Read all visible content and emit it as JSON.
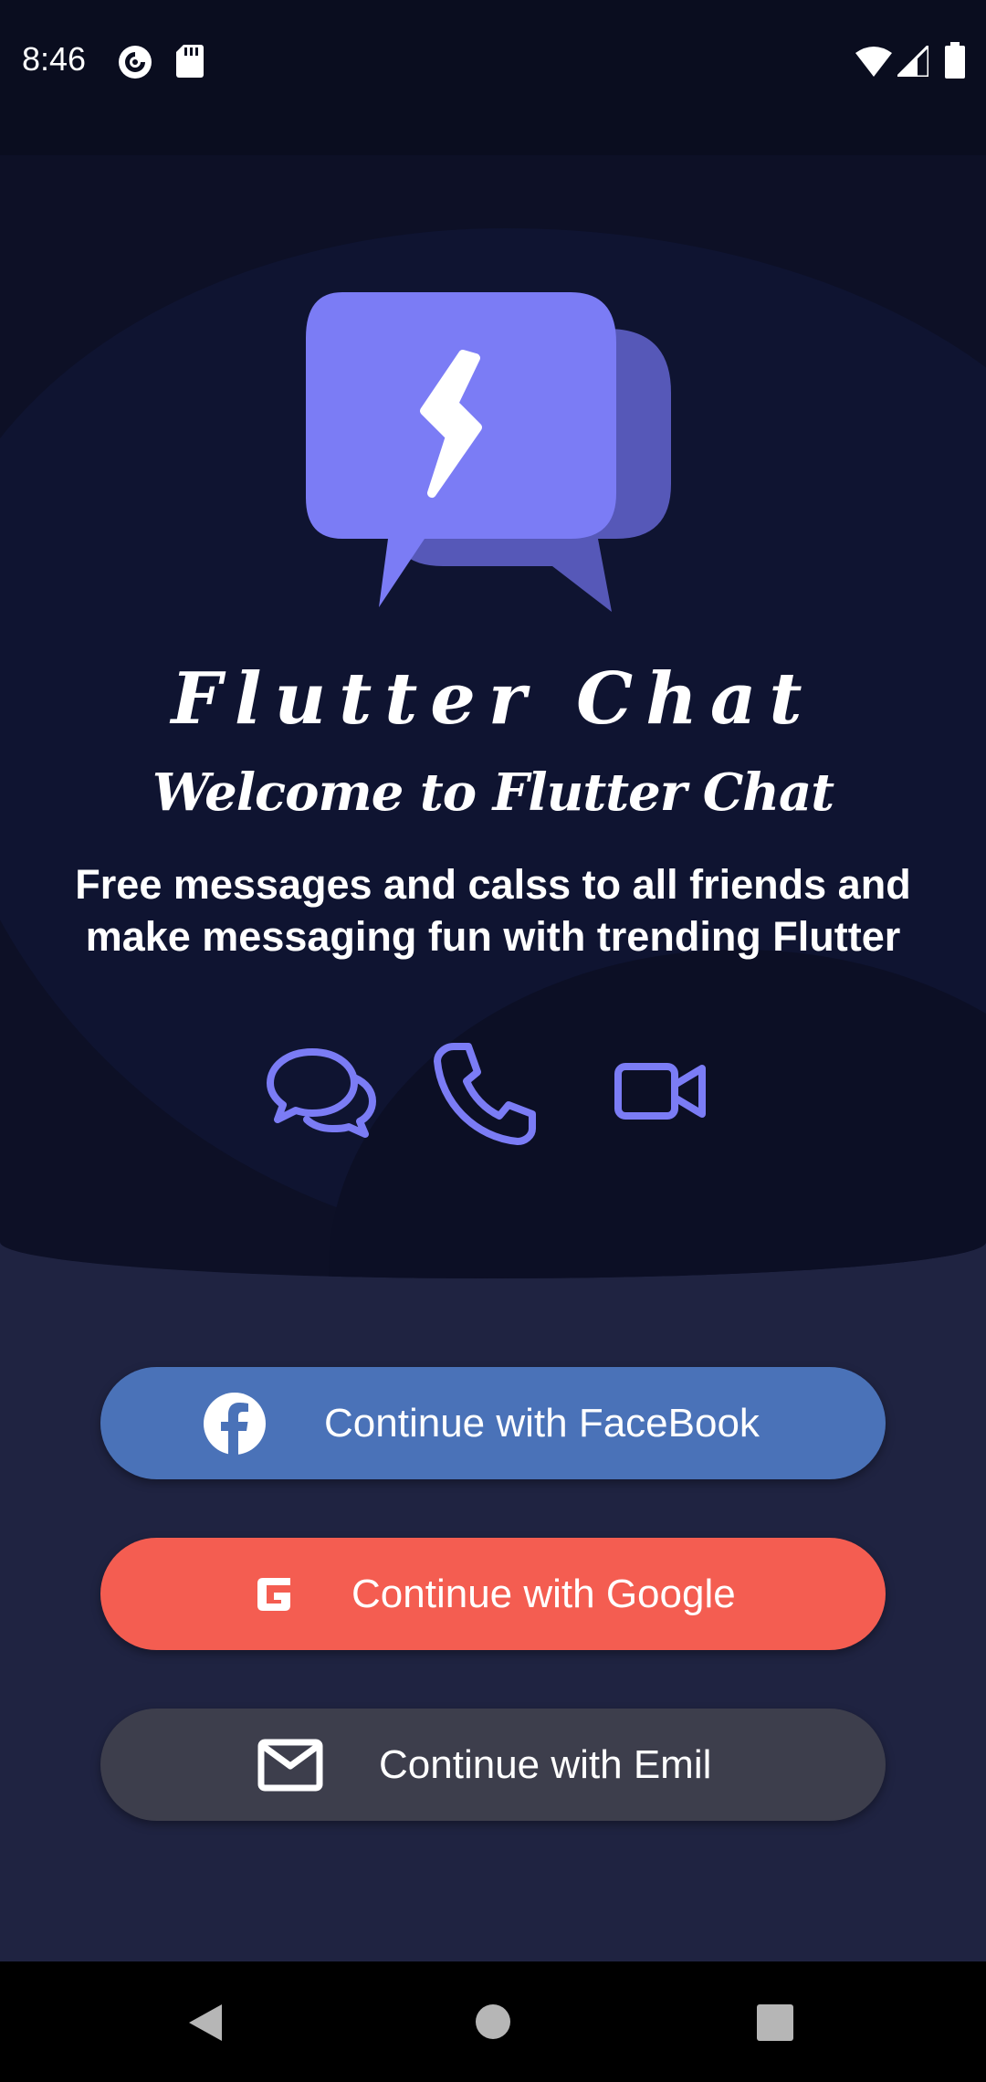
{
  "status_bar": {
    "time": "8:46",
    "left_icons": [
      "pocket-casts-icon",
      "sd-card-icon"
    ],
    "right_icons": [
      "wifi-icon",
      "signal-icon",
      "battery-icon"
    ]
  },
  "app": {
    "name": "Flutter Chat",
    "welcome": "Welcome to Flutter Chat",
    "tagline": "Free messages and calss to all friends and make messaging fun with trending Flutter"
  },
  "features": [
    {
      "icon": "chat-bubbles-icon"
    },
    {
      "icon": "phone-icon"
    },
    {
      "icon": "video-camera-icon"
    }
  ],
  "auth_buttons": {
    "facebook": {
      "label": "Continue with FaceBook",
      "icon": "facebook-icon",
      "color": "#4a72b8"
    },
    "google": {
      "label": "Continue with Google",
      "icon": "google-icon",
      "color": "#f45d51"
    },
    "email": {
      "label": "Continue with Emil",
      "icon": "mail-icon",
      "color": "#3d3e4c"
    }
  },
  "colors": {
    "accent": "#7b7cf5",
    "hero_background": "#0d1026",
    "bottom_background": "#1f2341"
  },
  "nav_bar": {
    "buttons": [
      "back-icon",
      "home-icon",
      "recents-icon"
    ]
  }
}
